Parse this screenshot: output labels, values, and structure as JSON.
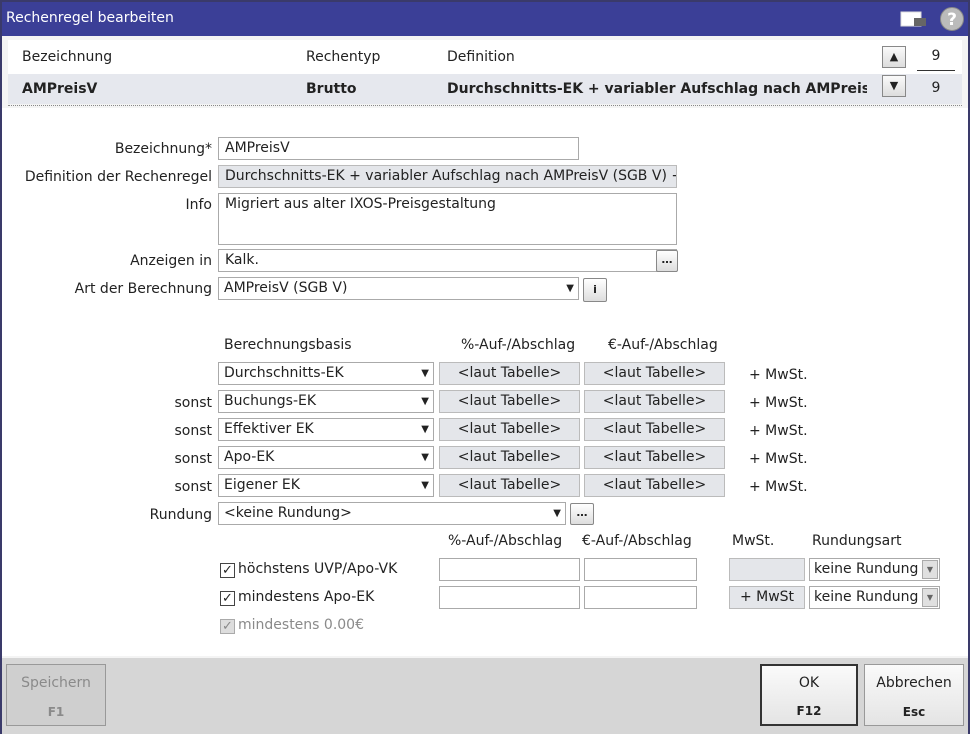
{
  "window": {
    "title": "Rechenregel bearbeiten"
  },
  "list": {
    "headers": {
      "bezeichnung": "Bezeichnung",
      "rechentyp": "Rechentyp",
      "definition": "Definition"
    },
    "row": {
      "bezeichnung": "AMPreisV",
      "rechentyp": "Brutto",
      "definition": "Durchschnitts-EK + variabler Aufschlag nach AMPreisV (SGB"
    },
    "page_top": "9",
    "page_bottom": "9"
  },
  "form": {
    "bezeichnung_label": "Bezeichnung*",
    "bezeichnung_value": "AMPreisV",
    "definition_label": "Definition der Rechenregel",
    "definition_value": "Durchschnitts-EK + variabler Aufschlag nach AMPreisV (SGB V) +",
    "info_label": "Info",
    "info_value": "Migriert aus alter IXOS-Preisgestaltung",
    "anzeigen_label": "Anzeigen in",
    "anzeigen_value": "Kalk.",
    "art_label": "Art der Berechnung",
    "art_value": "AMPreisV (SGB V)",
    "info_button": "i"
  },
  "calc": {
    "headers": {
      "basis": "Berechnungsbasis",
      "pct": "%-Auf-/Abschlag",
      "eur": "€-Auf-/Abschlag"
    },
    "rows": [
      {
        "prefix": "",
        "basis": "Durchschnitts-EK",
        "pct": "<laut Tabelle>",
        "eur": "<laut Tabelle>",
        "mwst": "+ MwSt."
      },
      {
        "prefix": "sonst",
        "basis": "Buchungs-EK",
        "pct": "<laut Tabelle>",
        "eur": "<laut Tabelle>",
        "mwst": "+ MwSt."
      },
      {
        "prefix": "sonst",
        "basis": "Effektiver EK",
        "pct": "<laut Tabelle>",
        "eur": "<laut Tabelle>",
        "mwst": "+ MwSt."
      },
      {
        "prefix": "sonst",
        "basis": "Apo-EK",
        "pct": "<laut Tabelle>",
        "eur": "<laut Tabelle>",
        "mwst": "+ MwSt."
      },
      {
        "prefix": "sonst",
        "basis": "Eigener EK",
        "pct": "<laut Tabelle>",
        "eur": "<laut Tabelle>",
        "mwst": "+ MwSt."
      }
    ],
    "rundung_label": "Rundung",
    "rundung_value": "<keine Rundung>"
  },
  "limits": {
    "headers": {
      "pct": "%-Auf-/Abschlag",
      "eur": "€-Auf-/Abschlag",
      "mwst": "MwSt.",
      "rundungsart": "Rundungsart"
    },
    "rows": [
      {
        "label": "höchstens UVP/Apo-VK",
        "checked": true,
        "pct": "",
        "eur": "",
        "mwst": "",
        "rundungsart": "keine Rundung"
      },
      {
        "label": "mindestens Apo-EK",
        "checked": true,
        "pct": "",
        "eur": "",
        "mwst": "+ MwSt",
        "rundungsart": "keine Rundung"
      }
    ],
    "min_label": "mindestens 0.00€"
  },
  "footer": {
    "save": {
      "label": "Speichern",
      "key": "F1"
    },
    "ok": {
      "label": "OK",
      "key": "F12"
    },
    "cancel": {
      "label": "Abbrechen",
      "key": "Esc"
    }
  }
}
